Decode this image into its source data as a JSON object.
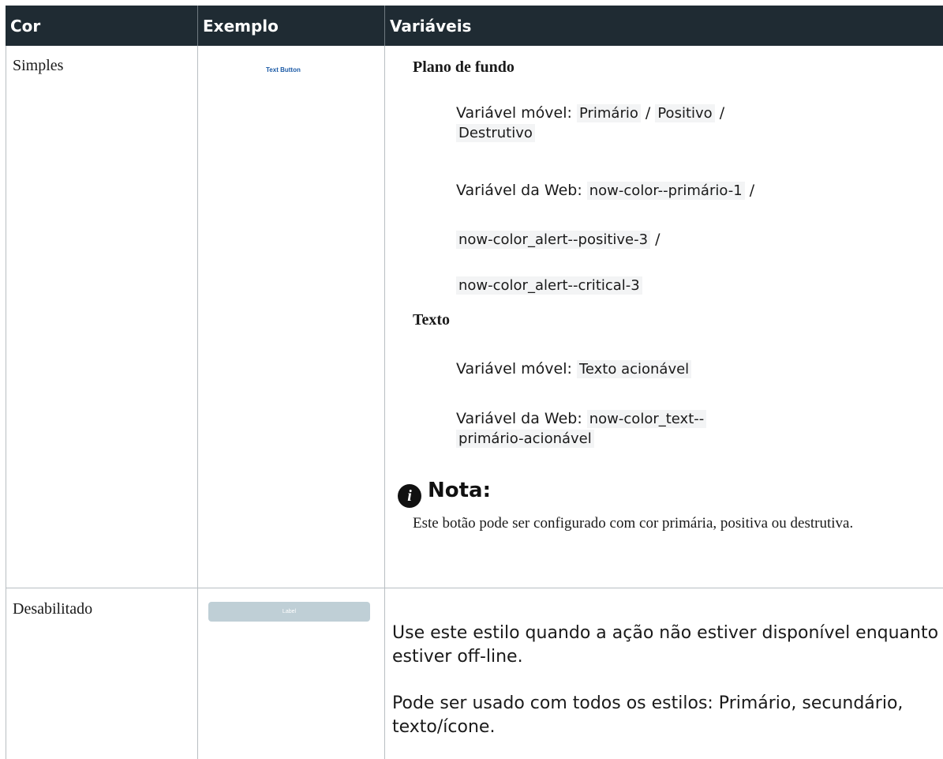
{
  "headers": {
    "col1": "Cor",
    "col2": "Exemplo",
    "col3": "Variáveis"
  },
  "rows": {
    "simples": {
      "label": "Simples",
      "example_label": "Text Button",
      "background": {
        "heading": "Plano de fundo",
        "mobile_prefix": "Variável móvel: ",
        "mobile_primary": "Primário",
        "mobile_positive": "Positivo",
        "mobile_destructive": "Destrutivo",
        "sep": " / ",
        "web_prefix": "Variável da Web: ",
        "web_primary": "now-color--primário-1",
        "web_positive": "now-color_alert--positive-3",
        "web_critical": "now-color_alert--critical-3"
      },
      "text": {
        "heading": "Texto",
        "mobile_prefix": "Variável móvel: ",
        "mobile_value": "Texto acionável",
        "web_prefix": "Variável da Web: ",
        "web_value_line1": "now-color_text--",
        "web_value_line2": "primário-acionável"
      },
      "note": {
        "title": "Nota:",
        "body": "Este botão pode ser configurado com cor primária, positiva ou destrutiva."
      }
    },
    "desabilitado": {
      "label": "Desabilitado",
      "example_label": "Label",
      "paragraph1": "Use este estilo quando a ação não estiver disponível enquanto estiver off-line.",
      "paragraph2": "Pode ser usado com todos os estilos: Primário, secundário, texto/ícone."
    }
  },
  "colors": {
    "header_bg": "#1f2b33",
    "link_blue": "#1b5aa6",
    "disabled_button": "#bfcfd6",
    "code_bg": "#f3f4f5"
  },
  "icons": {
    "note": "info-icon"
  }
}
